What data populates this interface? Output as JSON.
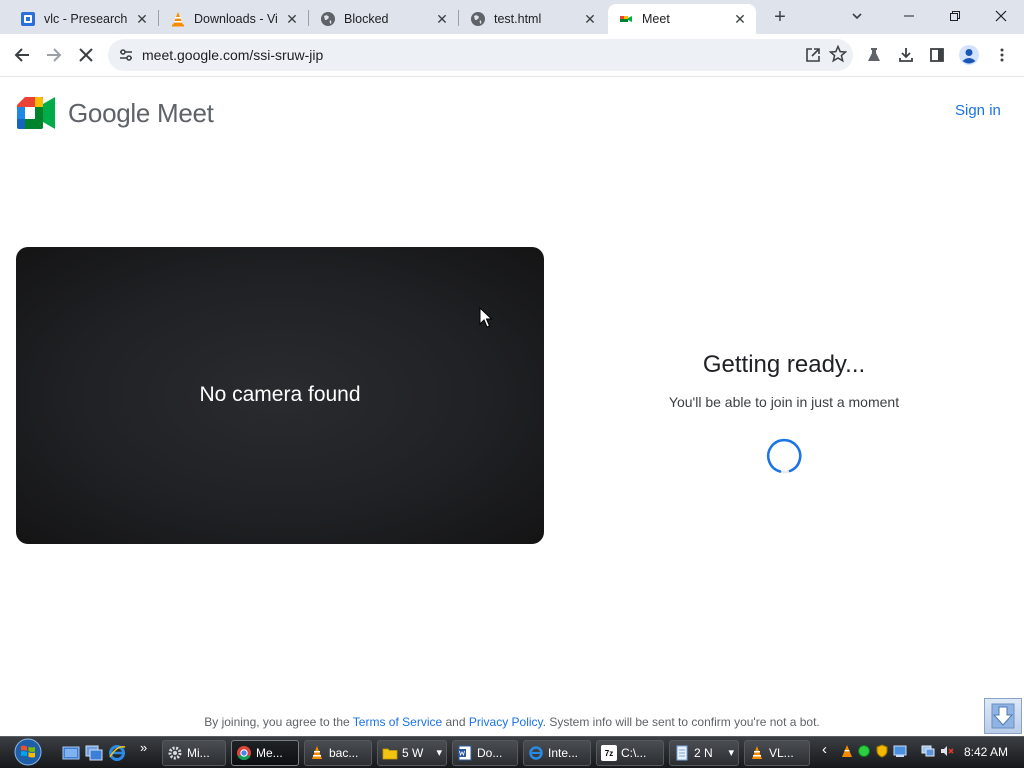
{
  "browser": {
    "tabs": [
      {
        "title": "vlc - Presearch",
        "favicon": "presearch-icon"
      },
      {
        "title": "Downloads - Vi",
        "favicon": "vlc-cone-icon"
      },
      {
        "title": "Blocked",
        "favicon": "globe-icon"
      },
      {
        "title": "test.html",
        "favicon": "globe-icon"
      },
      {
        "title": "Meet",
        "favicon": "meet-icon",
        "active": true
      }
    ],
    "close_glyph": "✕",
    "new_tab_glyph": "+",
    "url": "meet.google.com/ssi-sruw-jip"
  },
  "page": {
    "logo_text": "Google Meet",
    "sign_in": "Sign in",
    "camera_status": "No camera found",
    "ready_title": "Getting ready...",
    "ready_subtitle": "You'll be able to join in just a moment",
    "footer": {
      "prefix": "By joining, you agree to the",
      "terms": "Terms of Service",
      "and": "and",
      "privacy": "Privacy Policy",
      "suffix": ". System info will be sent to confirm you're not a bot."
    }
  },
  "taskbar": {
    "more_glyph": "»",
    "items": [
      {
        "label": "Mi...",
        "icon": "settings-gear-icon"
      },
      {
        "label": "Me...",
        "icon": "chrome-icon",
        "active": true
      },
      {
        "label": "bac...",
        "icon": "vlc-cone-icon"
      },
      {
        "label": "5 W",
        "icon": "folder-icon",
        "dropdown": "▾"
      },
      {
        "label": "Do...",
        "icon": "word-document-icon"
      },
      {
        "label": "Inte...",
        "icon": "internet-explorer-icon"
      },
      {
        "label": "C:\\...",
        "icon": "7zip-icon"
      },
      {
        "label": "2 N",
        "icon": "notepad-icon",
        "dropdown": "▾"
      },
      {
        "label": "VL...",
        "icon": "vlc-cone-icon"
      }
    ],
    "tray_chevron": "‹",
    "clock": "8:42 AM"
  },
  "colors": {
    "accent": "#1a73e8",
    "tabstrip": "#dfe3eb",
    "preview_bg": "#202124"
  }
}
